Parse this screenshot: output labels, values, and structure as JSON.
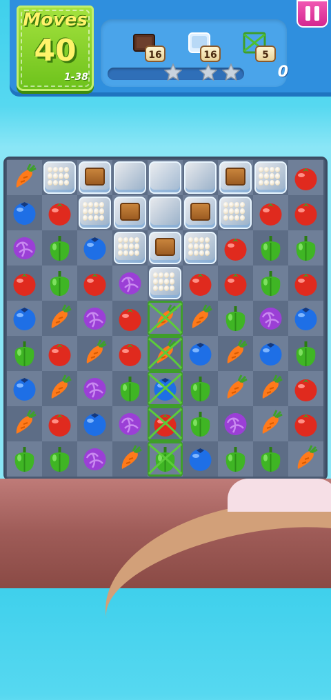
{
  "moves": {
    "label": "Moves",
    "count": "40",
    "level": "1-38"
  },
  "goals": [
    {
      "icon": "chocolate-crate-icon",
      "count": "16"
    },
    {
      "icon": "ice-block-icon",
      "count": "16"
    },
    {
      "icon": "vine-net-icon",
      "count": "5"
    }
  ],
  "score": "0",
  "stars": 3,
  "progress": 0,
  "colors": {
    "tomato": "#e02a1e",
    "carrot": "#ff7a1a",
    "pepper": "#3fb524",
    "blueberry": "#1e6fe6",
    "cabbage": "#9b3fd6"
  },
  "board": {
    "rows": 9,
    "cols": 9,
    "cells": [
      [
        "carrot",
        "eggs",
        "crate",
        "ice",
        "ice",
        "ice",
        "crate",
        "eggs",
        "tomato"
      ],
      [
        "blueberry",
        "tomato",
        "eggs",
        "crate",
        "ice",
        "crate",
        "eggs",
        "tomato",
        "tomato"
      ],
      [
        "cabbage",
        "pepper",
        "blueberry",
        "eggs",
        "crate",
        "eggs",
        "tomato",
        "pepper",
        "pepper"
      ],
      [
        "tomato",
        "pepper",
        "tomato",
        "cabbage",
        "eggs",
        "tomato",
        "tomato",
        "pepper",
        "tomato"
      ],
      [
        "blueberry",
        "carrot",
        "cabbage",
        "tomato",
        "carrot",
        "carrot",
        "pepper",
        "cabbage",
        "blueberry"
      ],
      [
        "pepper",
        "tomato",
        "carrot",
        "tomato",
        "carrot",
        "blueberry",
        "carrot",
        "blueberry",
        "pepper"
      ],
      [
        "blueberry",
        "carrot",
        "cabbage",
        "pepper",
        "blueberry",
        "pepper",
        "carrot",
        "carrot",
        "tomato"
      ],
      [
        "carrot",
        "tomato",
        "blueberry",
        "cabbage",
        "tomato",
        "pepper",
        "cabbage",
        "carrot",
        "tomato"
      ],
      [
        "pepper",
        "pepper",
        "cabbage",
        "carrot",
        "pepper",
        "blueberry",
        "pepper",
        "pepper",
        "carrot"
      ]
    ],
    "vines": [
      [
        4,
        4
      ],
      [
        5,
        4
      ],
      [
        6,
        4
      ],
      [
        7,
        4
      ],
      [
        8,
        4
      ]
    ]
  }
}
